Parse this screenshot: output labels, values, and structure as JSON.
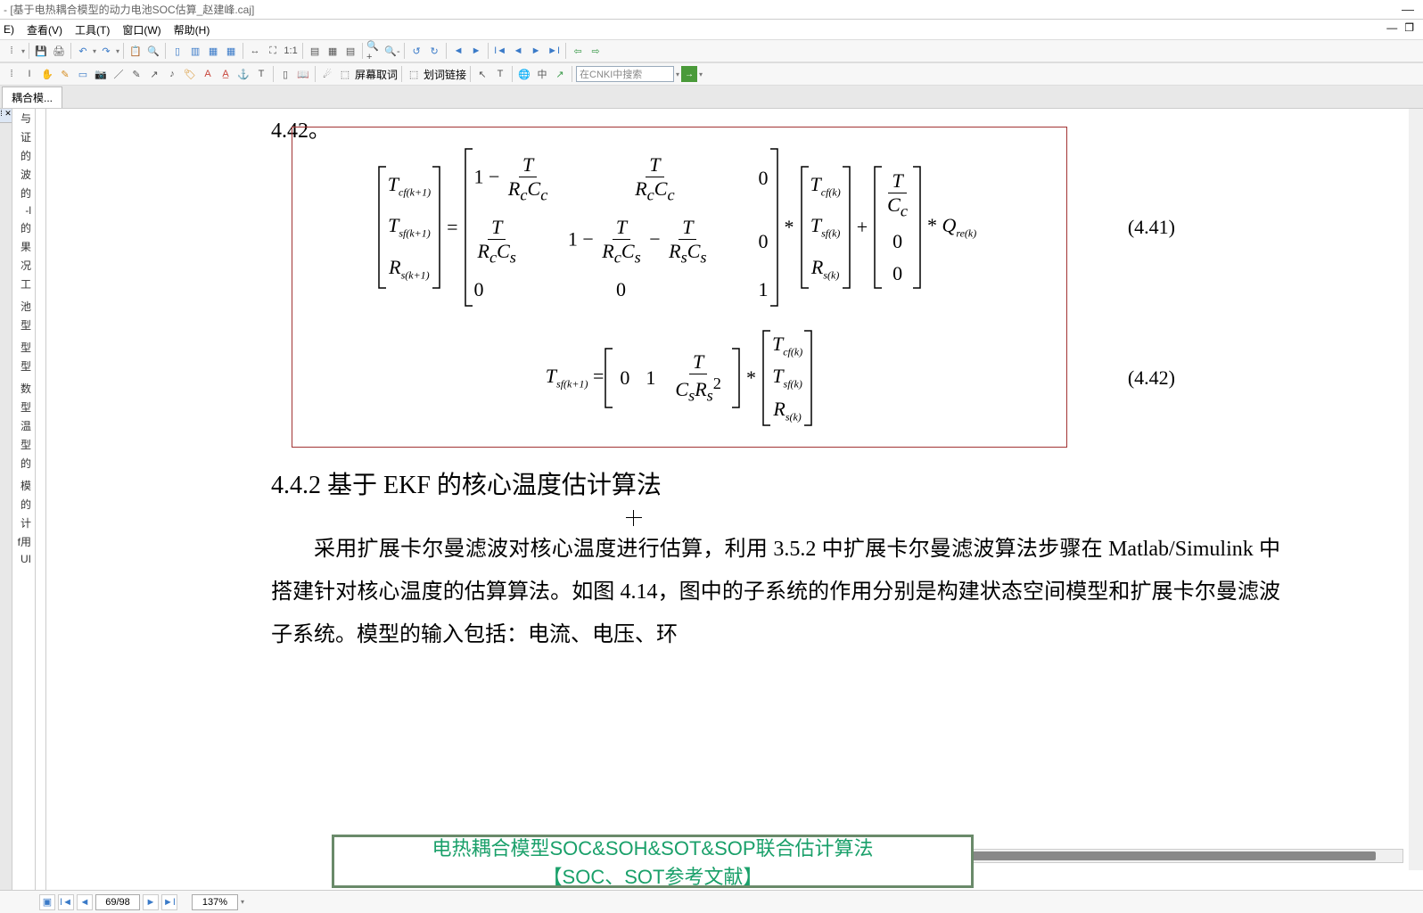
{
  "window": {
    "title": "- [基于电热耦合模型的动力电池SOC估算_赵建峰.caj]",
    "tab_title": "耦合模..."
  },
  "menus": {
    "edit": "E)",
    "view": "查看(V)",
    "tools": "工具(T)",
    "window": "窗口(W)",
    "help": "帮助(H)"
  },
  "toolbar2": {
    "screen_capture": "屏幕取词",
    "word_link": "划词链接",
    "cnki_placeholder": "在CNKI中搜索"
  },
  "document": {
    "frag_top": "4.42。",
    "eq441_num": "(4.41)",
    "eq442_num": "(4.42)",
    "heading_442": "4.4.2 基于 EKF 的核心温度估计算法",
    "body_p1": "采用扩展卡尔曼滤波对核心温度进行估算，利用 3.5.2 中扩展卡尔曼滤波算法步骤在 Matlab/Simulink 中搭建针对核心温度的估算算法。如图 4.14，图中的子系统的作用分别是构建状态空间模型和扩展卡尔曼滤波子系统。模型的输入包括：电流、电压、环",
    "banner_line1": "电热耦合模型SOC&SOH&SOT&SOP联合估计算法",
    "banner_line2": "【SOC、SOT参考文献】"
  },
  "status": {
    "page": "69/98",
    "zoom": "137%"
  },
  "outline_items": [
    "与",
    "证",
    "的",
    "波",
    "的",
    "-l",
    "的",
    "果",
    "况",
    "工",
    "",
    "池",
    "型",
    "",
    "型",
    "型",
    "",
    "数",
    "型",
    "温",
    "型",
    "的",
    "",
    "模",
    "的",
    "计",
    "f用",
    "UI"
  ]
}
